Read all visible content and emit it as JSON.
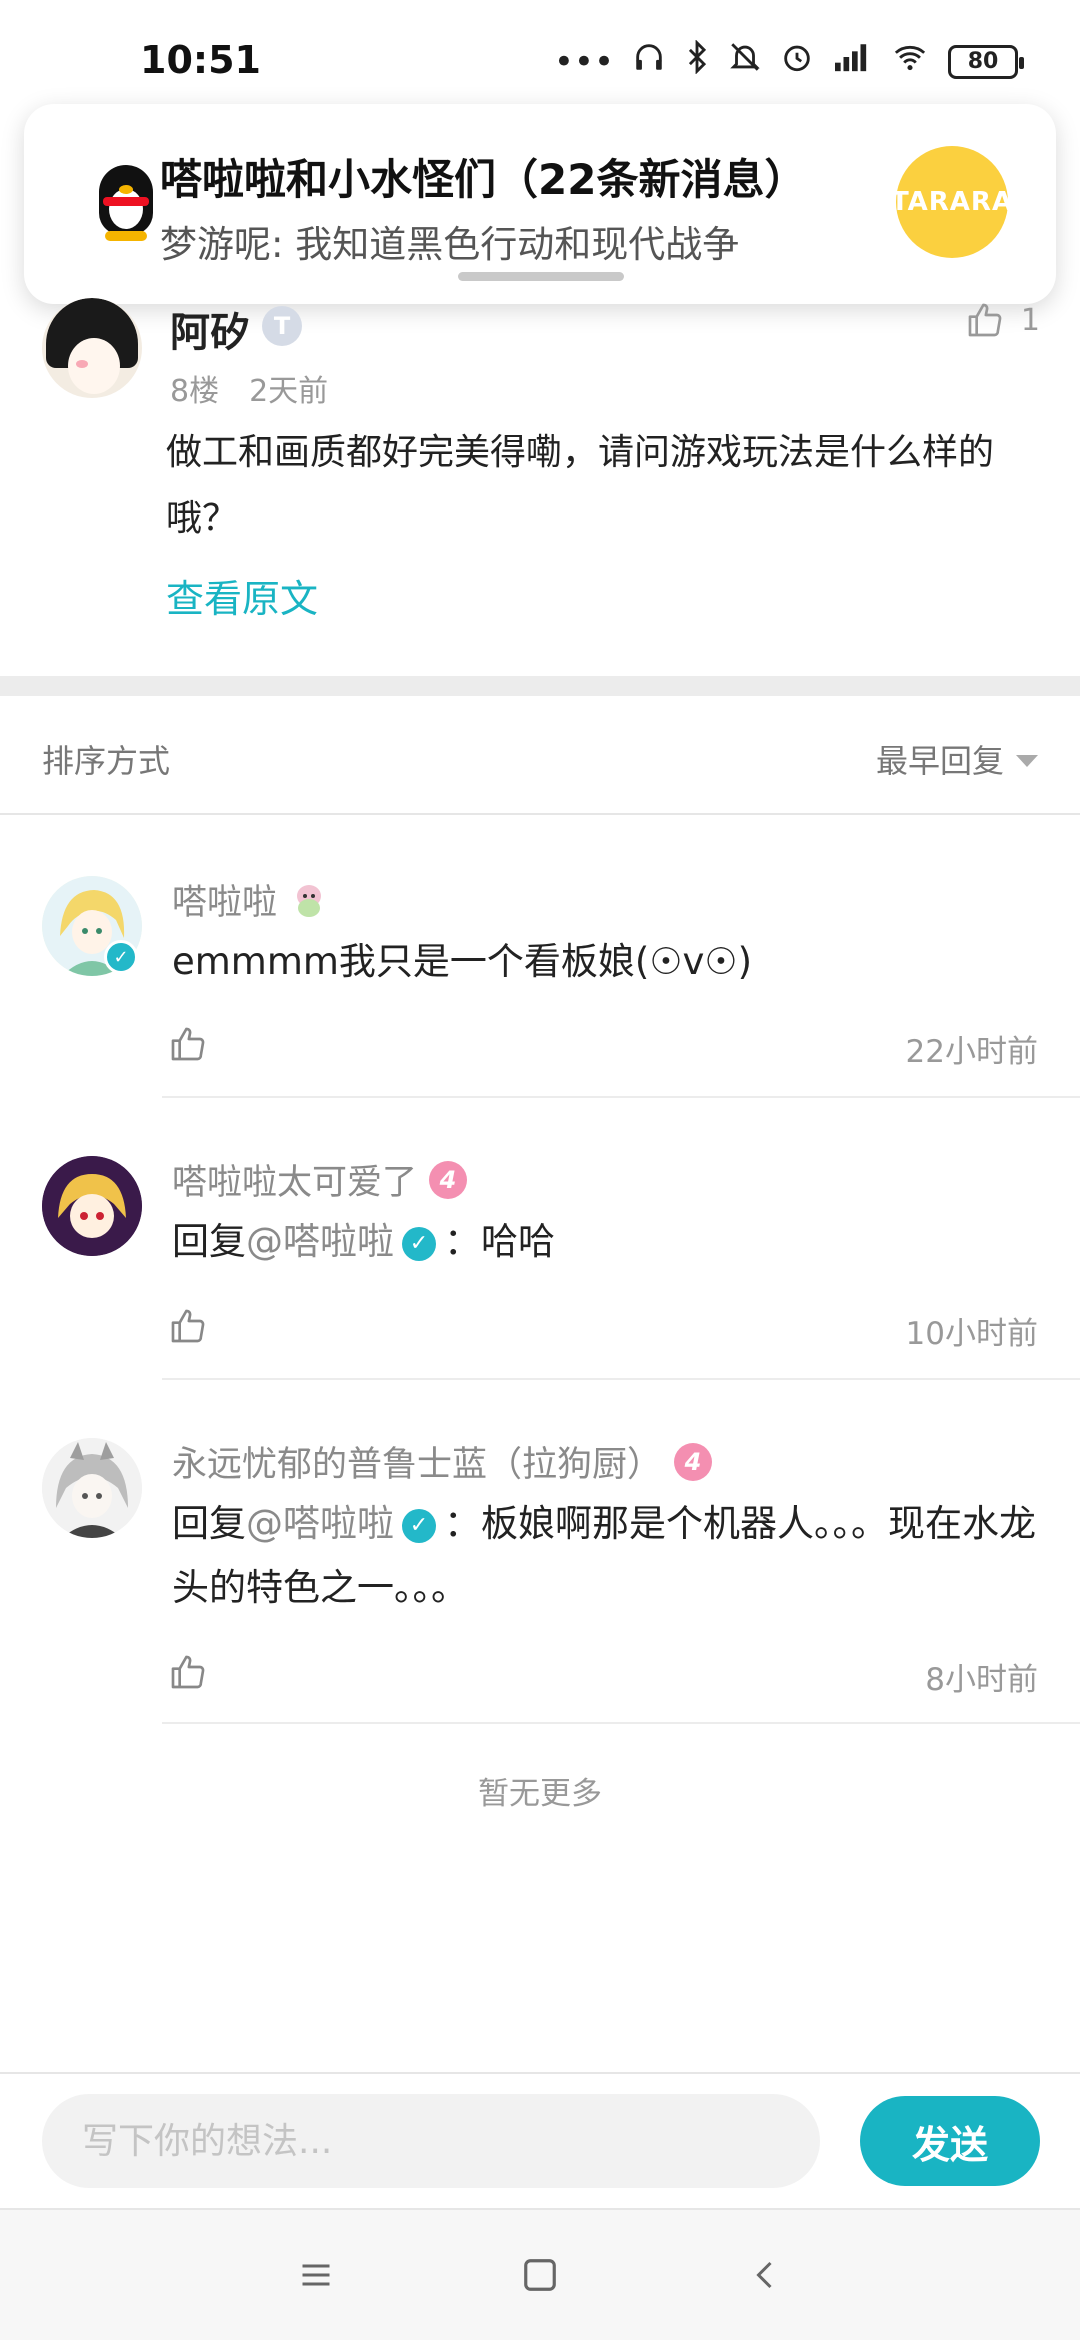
{
  "status_bar": {
    "time": "10:51",
    "battery": "80"
  },
  "notification": {
    "title": "嗒啦啦和小水怪们（22条新消息）",
    "body": "梦游呢: 我知道黑色行动和现代战争",
    "logo_text": "TARARA"
  },
  "original_comment": {
    "author": "阿矽",
    "badge": "T",
    "likes": "1",
    "floor": "8楼",
    "time": "2天前",
    "content": "做工和画质都好完美得嘞，请问游戏玩法是什么样的哦？",
    "view_original_label": "查看原文"
  },
  "sort": {
    "label": "排序方式",
    "selected": "最早回复"
  },
  "replies": [
    {
      "author": "嗒啦啦",
      "text": "emmmm我只是一个看板娘(☉v☉)",
      "time": "22小时前"
    },
    {
      "author": "嗒啦啦太可爱了",
      "level": "4",
      "reply_prefix": "回复",
      "mention": "@嗒啦啦",
      "text": "：哈哈",
      "time": "10小时前"
    },
    {
      "author": "永远忧郁的普鲁士蓝（拉狗厨）",
      "level": "4",
      "reply_prefix": "回复",
      "mention": "@嗒啦啦",
      "text": "：板娘啊那是个机器人。。。现在水龙头的特色之一。。。",
      "time": "8小时前"
    }
  ],
  "no_more_label": "暂无更多",
  "input": {
    "placeholder": "写下你的想法..."
  },
  "send_label": "发送",
  "colors": {
    "accent": "#19b4c3",
    "level_badge": "#f48fb1",
    "logo_yellow": "#fbd03f"
  },
  "icons": {
    "like": "thumbs-up-icon",
    "menu": "menu-icon",
    "home": "home-square-icon",
    "back": "back-chevron-icon"
  }
}
